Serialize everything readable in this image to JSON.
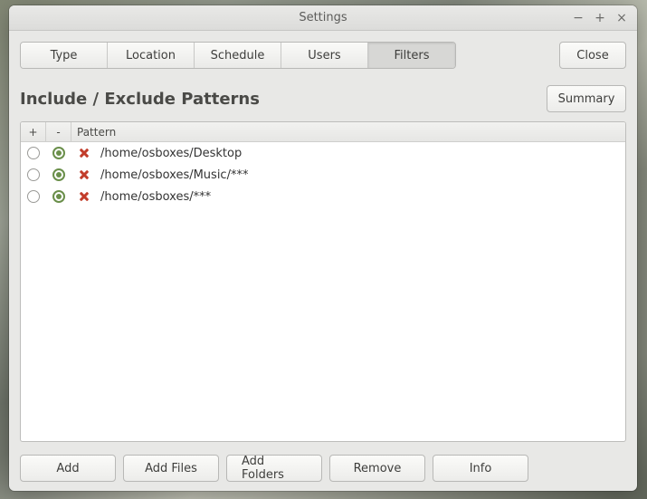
{
  "window": {
    "title": "Settings"
  },
  "tabs": {
    "items": [
      "Type",
      "Location",
      "Schedule",
      "Users",
      "Filters"
    ],
    "active_index": 4
  },
  "close_label": "Close",
  "heading": "Include / Exclude Patterns",
  "summary_label": "Summary",
  "table": {
    "headers": {
      "plus": "+",
      "minus": "-",
      "pattern": "Pattern"
    },
    "rows": [
      {
        "include_selected": false,
        "exclude_selected": true,
        "pattern": "/home/osboxes/Desktop"
      },
      {
        "include_selected": false,
        "exclude_selected": true,
        "pattern": "/home/osboxes/Music/***"
      },
      {
        "include_selected": false,
        "exclude_selected": true,
        "pattern": "/home/osboxes/***"
      }
    ]
  },
  "buttons": {
    "add": "Add",
    "add_files": "Add Files",
    "add_folders": "Add Folders",
    "remove": "Remove",
    "info": "Info"
  }
}
